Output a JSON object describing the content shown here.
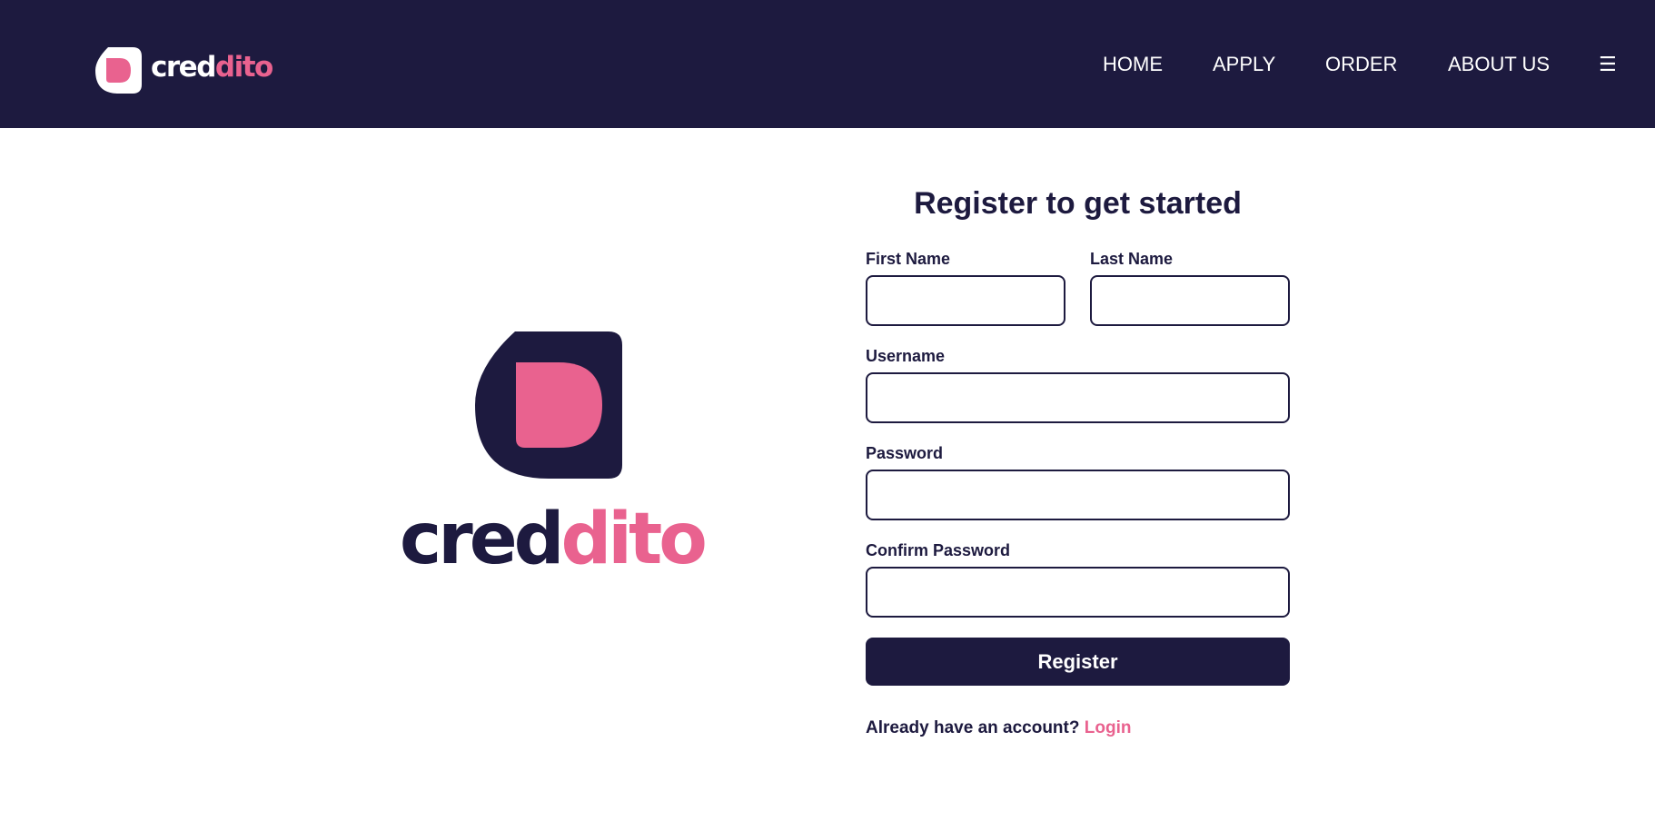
{
  "brand": {
    "wordmark_part1": "cred",
    "wordmark_part2": "dito"
  },
  "nav": {
    "items": [
      {
        "label": "HOME"
      },
      {
        "label": "APPLY"
      },
      {
        "label": "ORDER"
      },
      {
        "label": "ABOUT US"
      }
    ],
    "menu_icon": "hamburger-menu-icon",
    "menu_glyph": "☰"
  },
  "form": {
    "title": "Register to get started",
    "first_name": {
      "label": "First Name",
      "value": ""
    },
    "last_name": {
      "label": "Last Name",
      "value": ""
    },
    "username": {
      "label": "Username",
      "value": ""
    },
    "password": {
      "label": "Password",
      "value": ""
    },
    "confirm_password": {
      "label": "Confirm Password",
      "value": ""
    },
    "submit_label": "Register",
    "login_prompt": "Already have an account?",
    "login_link": "Login"
  },
  "colors": {
    "navy": "#1d1a3f",
    "pink": "#e9628f",
    "white": "#ffffff"
  }
}
